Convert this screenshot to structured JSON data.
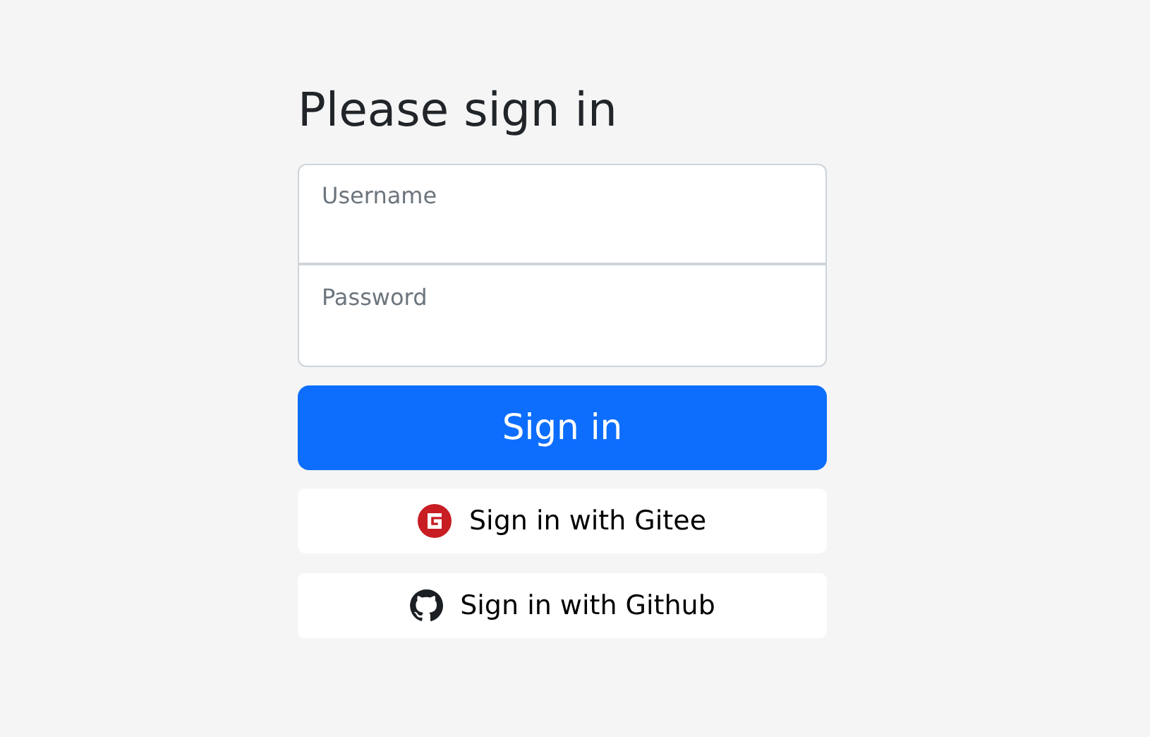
{
  "heading": "Please sign in",
  "fields": [
    {
      "placeholder": "Username"
    },
    {
      "placeholder": "Password"
    }
  ],
  "submit": "Sign in",
  "providers": [
    {
      "label": "Sign in with Gitee",
      "kind": "gitee"
    },
    {
      "label": "Sign in with Github",
      "kind": "github"
    }
  ]
}
